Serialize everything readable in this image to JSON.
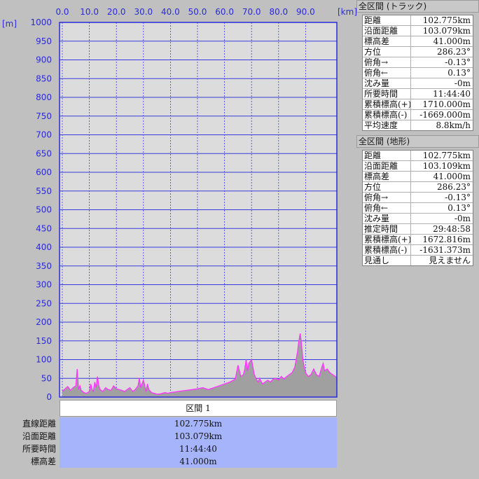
{
  "chart_data": {
    "type": "area",
    "xlabel_unit": "[km]",
    "ylabel_unit": "[m]",
    "xlim": [
      0,
      102.775
    ],
    "ylim": [
      0,
      1000
    ],
    "x_ticks": [
      "0.0",
      "10.0",
      "20.0",
      "30.0",
      "40.0",
      "50.0",
      "60.0",
      "70.0",
      "80.0",
      "90.0"
    ],
    "y_ticks": [
      "1000",
      "950",
      "900",
      "850",
      "800",
      "750",
      "700",
      "650",
      "600",
      "550",
      "500",
      "450",
      "400",
      "350",
      "300",
      "250",
      "200",
      "150",
      "100",
      "50",
      "0"
    ],
    "grid": true,
    "colors": {
      "plot_bg": "#dcdcdc",
      "grid": "#3a3ae0",
      "fill": "#a0a0a0",
      "line": "#ff33ff"
    },
    "series": [
      {
        "x": [
          0,
          1,
          2,
          3,
          4,
          5,
          5.5,
          6,
          6.5,
          7,
          8,
          9,
          10,
          10.5,
          11,
          11.5,
          12,
          12.5,
          13,
          13.5,
          14,
          15,
          16,
          17,
          18,
          19,
          20,
          21,
          22,
          23,
          24,
          25,
          26,
          27,
          28,
          28.5,
          29,
          30,
          31,
          31.5,
          32,
          33,
          34,
          35,
          36,
          37,
          38,
          39,
          40,
          42,
          44,
          46,
          48,
          50,
          52,
          54,
          56,
          58,
          60,
          62,
          64,
          65,
          66,
          67,
          67.5,
          68,
          68.5,
          69,
          69.5,
          70,
          71,
          72,
          72.5,
          73,
          74,
          75,
          76,
          77,
          78,
          79,
          80,
          81,
          82,
          83,
          84,
          85,
          86,
          86.5,
          87,
          87.5,
          88,
          88.5,
          89,
          89.5,
          90,
          91,
          92,
          93,
          94,
          95,
          96,
          96.5,
          97,
          98,
          99,
          100,
          101,
          102,
          102.775
        ],
        "y": [
          15,
          22,
          28,
          18,
          25,
          30,
          75,
          20,
          30,
          18,
          12,
          10,
          15,
          35,
          20,
          15,
          40,
          25,
          55,
          30,
          20,
          15,
          25,
          20,
          18,
          30,
          22,
          20,
          18,
          15,
          20,
          25,
          15,
          20,
          30,
          50,
          25,
          45,
          15,
          35,
          20,
          12,
          10,
          8,
          8,
          10,
          12,
          10,
          12,
          14,
          16,
          18,
          20,
          22,
          25,
          20,
          25,
          30,
          35,
          40,
          48,
          85,
          55,
          60,
          75,
          100,
          70,
          90,
          95,
          100,
          60,
          45,
          40,
          50,
          35,
          40,
          45,
          40,
          48,
          50,
          45,
          55,
          48,
          55,
          60,
          65,
          80,
          100,
          120,
          150,
          170,
          140,
          100,
          80,
          65,
          55,
          60,
          75,
          60,
          55,
          80,
          90,
          70,
          75,
          65,
          60,
          55,
          50,
          41
        ]
      }
    ]
  },
  "panels": [
    {
      "title": "全区間 (トラック)",
      "rows": [
        {
          "k": "距離",
          "v": "102.775km"
        },
        {
          "k": "沿面距離",
          "v": "103.079km"
        },
        {
          "k": "標高差",
          "v": "41.000m"
        },
        {
          "k": "方位",
          "v": "286.23°"
        },
        {
          "k": "俯角→",
          "v": "-0.13°"
        },
        {
          "k": "俯角←",
          "v": "0.13°"
        },
        {
          "k": "沈み量",
          "v": "-0m"
        },
        {
          "k": "所要時間",
          "v": "11:44:40"
        },
        {
          "k": "累積標高(+)",
          "v": "1710.000m"
        },
        {
          "k": "累積標高(-)",
          "v": "-1669.000m"
        },
        {
          "k": "平均速度",
          "v": "8.8km/h"
        }
      ]
    },
    {
      "title": "全区間 (地形)",
      "rows": [
        {
          "k": "距離",
          "v": "102.775km"
        },
        {
          "k": "沿面距離",
          "v": "103.109km"
        },
        {
          "k": "標高差",
          "v": "41.000m"
        },
        {
          "k": "方位",
          "v": "286.23°"
        },
        {
          "k": "俯角→",
          "v": "-0.13°"
        },
        {
          "k": "俯角←",
          "v": "0.13°"
        },
        {
          "k": "沈み量",
          "v": "-0m"
        },
        {
          "k": "推定時間",
          "v": "29:48:58"
        },
        {
          "k": "累積標高(+)",
          "v": "1672.816m"
        },
        {
          "k": "累積標高(-)",
          "v": "-1631.373m"
        },
        {
          "k": "見通し",
          "v": "見えません"
        }
      ]
    }
  ],
  "segment": {
    "header": "区間 1",
    "labels": [
      "直線距離",
      "沿面距離",
      "所要時間",
      "標高差"
    ],
    "values": [
      "102.775km",
      "103.079km",
      "11:44:40",
      "41.000m"
    ]
  }
}
